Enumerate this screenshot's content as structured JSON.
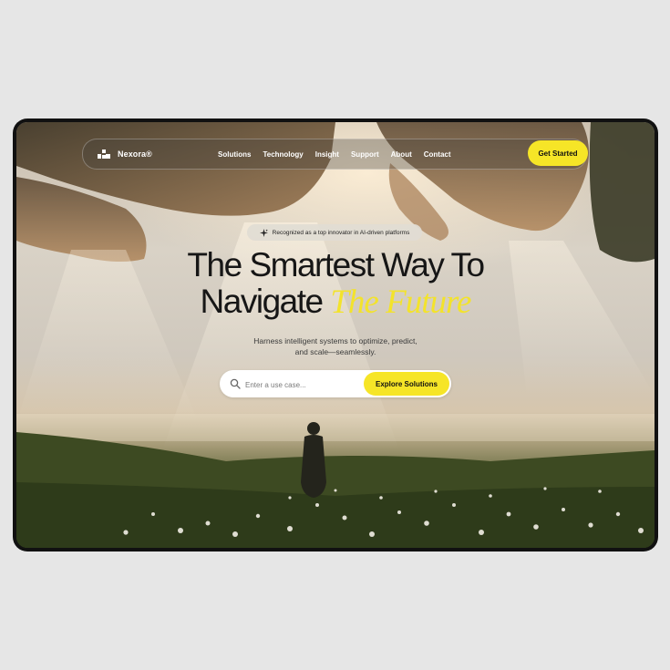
{
  "brand": {
    "name": "Nexora®",
    "logo_icon": "nexora-logo-icon"
  },
  "nav": {
    "items": [
      "Solutions",
      "Technology",
      "Insight",
      "Support",
      "About",
      "Contact"
    ],
    "cta_label": "Get Started"
  },
  "hero": {
    "badge_icon": "sparkle-icon",
    "badge": "Recognized as a top innovator in AI-driven platforms",
    "headline_line1": "The Smartest Way To",
    "headline_line2": "Navigate",
    "headline_accent": "The Future",
    "subtitle_line1": "Harness intelligent systems to optimize, predict,",
    "subtitle_line2": "and scale—seamlessly."
  },
  "search": {
    "icon": "search-icon",
    "placeholder": "Enter a use case...",
    "value": "",
    "button_label": "Explore Solutions"
  },
  "colors": {
    "accent": "#f6e527",
    "page_background": "#e6e6e6",
    "frame": "#111111",
    "headline": "#161616"
  }
}
